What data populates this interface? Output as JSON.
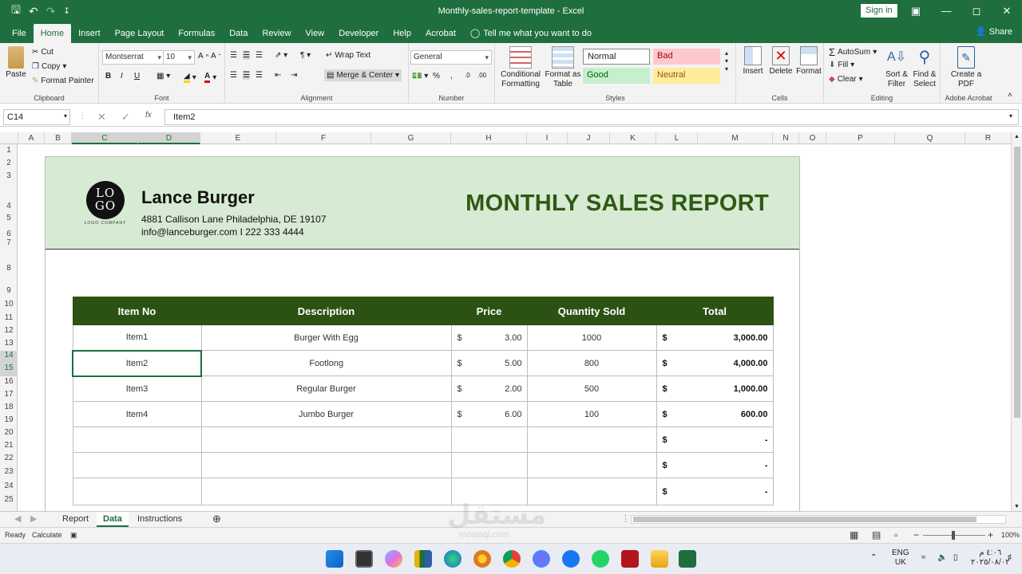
{
  "window": {
    "title": "Monthly-sales-report-template  -  Excel",
    "sign_in": "Sign in",
    "share": "Share"
  },
  "tabs": [
    "File",
    "Home",
    "Insert",
    "Page Layout",
    "Formulas",
    "Data",
    "Review",
    "View",
    "Developer",
    "Help",
    "Acrobat"
  ],
  "tell_me": "Tell me what you want to do",
  "ribbon": {
    "clipboard": {
      "label": "Clipboard",
      "paste": "Paste",
      "cut": "Cut",
      "copy": "Copy",
      "format_painter": "Format Painter"
    },
    "font": {
      "label": "Font",
      "name": "Montserrat",
      "size": "10",
      "bold": "B",
      "italic": "I",
      "underline": "U"
    },
    "alignment": {
      "label": "Alignment",
      "wrap": "Wrap Text",
      "merge": "Merge & Center"
    },
    "number": {
      "label": "Number",
      "format": "General",
      "percent": "%",
      "comma": ","
    },
    "styles": {
      "label": "Styles",
      "conditional": "Conditional Formatting",
      "format_table": "Format as Table",
      "normal": "Normal",
      "bad": "Bad",
      "good": "Good",
      "neutral": "Neutral"
    },
    "cells": {
      "label": "Cells",
      "insert": "Insert",
      "delete": "Delete",
      "format": "Format"
    },
    "editing": {
      "label": "Editing",
      "autosum": "AutoSum",
      "fill": "Fill",
      "clear": "Clear",
      "sort": "Sort & Filter",
      "find": "Find & Select"
    },
    "acrobat": {
      "label": "Adobe Acrobat",
      "create": "Create a PDF"
    }
  },
  "formula_bar": {
    "cell_ref": "C14",
    "content": "Item2",
    "fx": "fx"
  },
  "columns": [
    "A",
    "B",
    "C",
    "D",
    "E",
    "F",
    "G",
    "H",
    "I",
    "J",
    "K",
    "L",
    "M",
    "N",
    "O",
    "P",
    "Q",
    "R"
  ],
  "rows": [
    "1",
    "2",
    "3",
    "4",
    "5",
    "6",
    "7",
    "8",
    "9",
    "10",
    "11",
    "12",
    "13",
    "14",
    "15",
    "16",
    "17",
    "18",
    "19",
    "20",
    "21",
    "22",
    "23",
    "24",
    "25"
  ],
  "report": {
    "logo_text": "LO GO",
    "logo_caption": "LOGO COMPANY",
    "company": "Lance Burger",
    "address": "4881 Callison Lane Philadelphia, DE 19107",
    "contact": "info@lanceburger.com I 222 333 4444",
    "title": "MONTHLY SALES REPORT",
    "headers": [
      "Item No",
      "Description",
      "Price",
      "Quantity Sold",
      "Total"
    ],
    "rows": [
      {
        "item": "Item1",
        "desc": "Burger With Egg",
        "cur": "$",
        "price": "3.00",
        "qty": "1000",
        "tcur": "$",
        "total": "3,000.00"
      },
      {
        "item": "Item2",
        "desc": "Footlong",
        "cur": "$",
        "price": "5.00",
        "qty": "800",
        "tcur": "$",
        "total": "4,000.00"
      },
      {
        "item": "Item3",
        "desc": "Regular Burger",
        "cur": "$",
        "price": "2.00",
        "qty": "500",
        "tcur": "$",
        "total": "1,000.00"
      },
      {
        "item": "Item4",
        "desc": "Jumbo Burger",
        "cur": "$",
        "price": "6.00",
        "qty": "100",
        "tcur": "$",
        "total": "600.00"
      },
      {
        "item": "",
        "desc": "",
        "cur": "",
        "price": "",
        "qty": "",
        "tcur": "$",
        "total": "-"
      },
      {
        "item": "",
        "desc": "",
        "cur": "",
        "price": "",
        "qty": "",
        "tcur": "$",
        "total": "-"
      },
      {
        "item": "",
        "desc": "",
        "cur": "",
        "price": "",
        "qty": "",
        "tcur": "$",
        "total": "-"
      }
    ]
  },
  "sheets": [
    "Report",
    "Data",
    "Instructions"
  ],
  "status": {
    "ready": "Ready",
    "calculate": "Calculate",
    "zoom": "100%"
  },
  "tray": {
    "lang1": "ENG",
    "lang2": "UK",
    "time": "٤:٠٦ م",
    "date": "٢٠٢٥/٠٨/٠٢"
  },
  "watermark": "مستقل",
  "watermark_sub": "mostaql.com",
  "colors": {
    "excel_green": "#1e6e3e",
    "header_green": "#2b5213",
    "banner": "#d7ead3",
    "title_green": "#2e5a14"
  }
}
